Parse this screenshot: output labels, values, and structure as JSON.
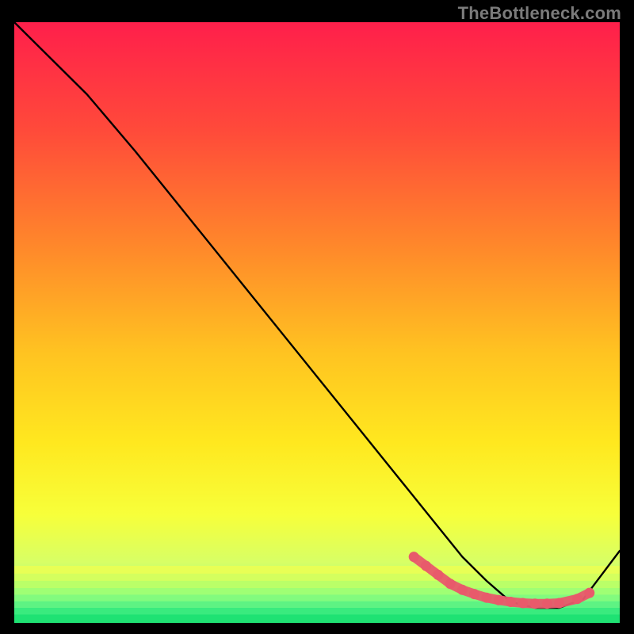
{
  "attribution": "TheBottleneck.com",
  "chart_data": {
    "type": "line",
    "title": "",
    "xlabel": "",
    "ylabel": "",
    "xlim": [
      0,
      100
    ],
    "ylim": [
      0,
      100
    ],
    "series": [
      {
        "name": "bottleneck-curve",
        "x": [
          0,
          6,
          12,
          20,
          30,
          40,
          50,
          60,
          66,
          70,
          74,
          78,
          82,
          86,
          90,
          94,
          100
        ],
        "values": [
          100,
          94,
          88,
          78.5,
          66,
          53.5,
          41,
          28.5,
          21,
          16,
          11,
          7,
          3.5,
          2.5,
          2.5,
          4,
          12
        ]
      }
    ],
    "markers": {
      "name": "highlighted-minimum",
      "x": [
        66,
        68,
        70,
        72,
        74,
        76,
        78,
        80,
        82,
        84,
        86,
        88,
        90,
        93,
        95
      ],
      "values": [
        11,
        9.5,
        8,
        6.5,
        5.5,
        4.8,
        4.2,
        3.8,
        3.5,
        3.3,
        3.2,
        3.2,
        3.3,
        4.0,
        5.0
      ]
    },
    "gradient_stops": [
      {
        "offset": 0.0,
        "color": "#ff1f4b"
      },
      {
        "offset": 0.18,
        "color": "#ff4a3a"
      },
      {
        "offset": 0.38,
        "color": "#ff8a2a"
      },
      {
        "offset": 0.55,
        "color": "#ffc321"
      },
      {
        "offset": 0.7,
        "color": "#ffe81f"
      },
      {
        "offset": 0.82,
        "color": "#f7ff3a"
      },
      {
        "offset": 0.9,
        "color": "#d7ff66"
      },
      {
        "offset": 0.95,
        "color": "#8dff86"
      },
      {
        "offset": 1.0,
        "color": "#1ee86f"
      }
    ],
    "marker_color": "#e85a6b",
    "curve_color": "#000000"
  }
}
